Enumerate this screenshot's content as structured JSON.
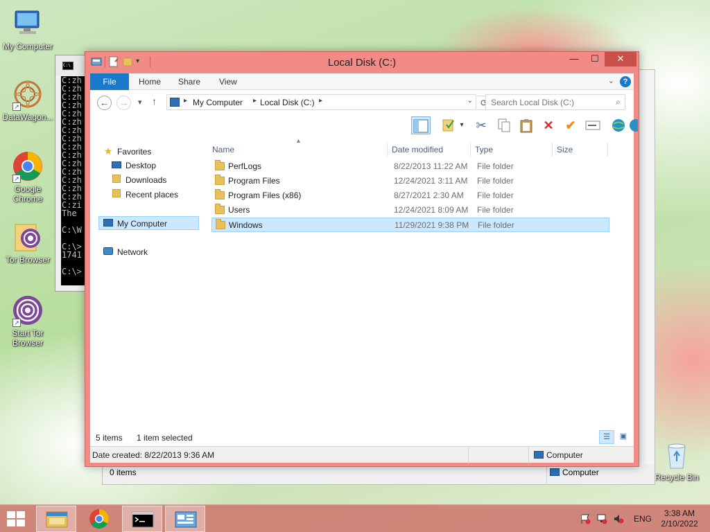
{
  "desktop": {
    "icons": [
      {
        "label": "My Computer"
      },
      {
        "label": "DataWagon..."
      },
      {
        "label": "Google Chrome"
      },
      {
        "label": "Tor Browser"
      },
      {
        "label": "Start Tor Browser"
      },
      {
        "label": "Recycle Bin"
      }
    ]
  },
  "cmd": {
    "icon_text": "C:\\",
    "lines": [
      "C:zh",
      "C:zh",
      "C:zh",
      "C:zh",
      "C:zh",
      "C:zh",
      "C:zh",
      "C:zh",
      "C:zh",
      "C:zh",
      "C:zh",
      "C:zh",
      "C:zh",
      "C:zh",
      "C:zh",
      "C:zi",
      "The ",
      "",
      "C:\\W",
      "",
      "C:\\>",
      "1741",
      "",
      "C:\\>"
    ]
  },
  "back_window": {
    "status_items": "0 items",
    "status_computer": "Computer"
  },
  "window": {
    "title": "Local Disk (C:)",
    "controls": {
      "minimize": "—",
      "maximize": "☐",
      "close": "✕"
    },
    "tabs": [
      "File",
      "Home",
      "Share",
      "View"
    ],
    "help": "?",
    "nav": {
      "back": "←",
      "forward": "→",
      "recent": "▾",
      "up": "↑"
    },
    "address": {
      "crumbs": [
        "My Computer",
        "Local Disk (C:)"
      ],
      "separator": "▸"
    },
    "search": {
      "placeholder": "Search Local Disk (C:)"
    },
    "nav_pane": {
      "favorites": "Favorites",
      "desktop": "Desktop",
      "downloads": "Downloads",
      "recent": "Recent places",
      "computer": "My Computer",
      "network": "Network"
    },
    "columns": [
      "Name",
      "Date modified",
      "Type",
      "Size"
    ],
    "rows": [
      {
        "name": "PerfLogs",
        "date": "8/22/2013 11:22 AM",
        "type": "File folder"
      },
      {
        "name": "Program Files",
        "date": "12/24/2021 3:11 AM",
        "type": "File folder"
      },
      {
        "name": "Program Files (x86)",
        "date": "8/27/2021 2:30 AM",
        "type": "File folder"
      },
      {
        "name": "Users",
        "date": "12/24/2021 8:09 AM",
        "type": "File folder"
      },
      {
        "name": "Windows",
        "date": "11/29/2021 9:38 PM",
        "type": "File folder"
      }
    ],
    "selected_row": "Windows",
    "item_count": "5 items",
    "selection": "1 item selected",
    "status_created": "Date created: 8/22/2013 9:36 AM",
    "status_computer": "Computer"
  },
  "taskbar": {
    "language": "ENG",
    "time": "3:38 AM",
    "date": "2/10/2022"
  },
  "colors": {
    "window_frame": "#f28b85",
    "file_tab": "#1979ca",
    "selection": "#cce8ff"
  }
}
